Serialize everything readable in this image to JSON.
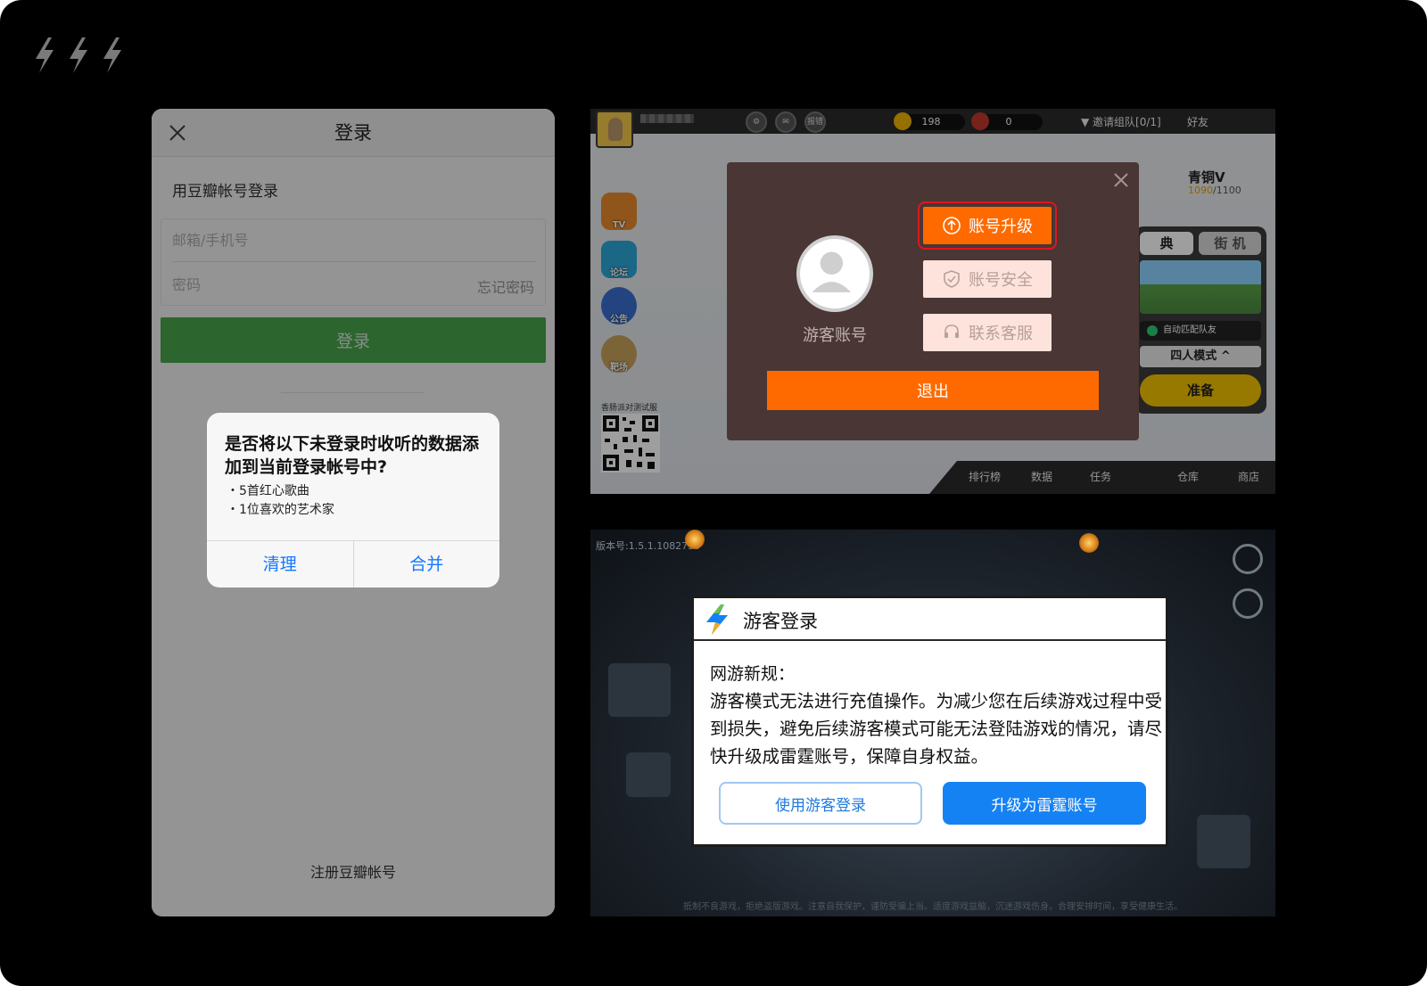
{
  "panel_login": {
    "title": "登录",
    "subtitle": "用豆瓣帐号登录",
    "email_placeholder": "邮箱/手机号",
    "password_placeholder": "密码",
    "forgot_password": "忘记密码",
    "login_button": "登录",
    "register_link": "注册豆瓣帐号",
    "dialog": {
      "title": "是否将以下未登录时收听的数据添加到当前登录帐号中?",
      "items": [
        "・5首红心歌曲",
        "・1位喜欢的艺术家"
      ],
      "clear_button": "清理",
      "merge_button": "合并"
    }
  },
  "panel_game_menu": {
    "coins": "198",
    "gems": "0",
    "report_label": "报错",
    "invite_team": "▼ 邀请组队[0/1]",
    "friends": "好友",
    "side_icons": [
      {
        "icon": "tv-icon",
        "label": "TV"
      },
      {
        "icon": "tap-forum-icon",
        "label": "论坛"
      },
      {
        "icon": "announcement-icon",
        "label": "公告"
      },
      {
        "icon": "range-icon",
        "label": "靶场"
      }
    ],
    "qr_label": "香肠派对测试服",
    "rank_name": "青铜V",
    "rank_points": "1090",
    "rank_points_max": "/1100",
    "tabs": [
      "典",
      "街 机"
    ],
    "auto_match": "自动匹配队友",
    "mode": "四人模式",
    "mode_arrow": "^",
    "ready": "准备",
    "bottom_nav": [
      "排行榜",
      "数据",
      "任务",
      "仓库",
      "商店"
    ],
    "modal": {
      "guest_account": "游客账号",
      "upgrade": "账号升级",
      "security": "账号安全",
      "service": "联系客服",
      "logout": "退出"
    },
    "colors": {
      "accent": "#ff6a00",
      "highlight": "#e0161d"
    }
  },
  "panel_guest_login": {
    "version": "版本号:1.5.1.1082730",
    "footer": "抵制不良游戏，拒绝盗版游戏。注意自我保护，谨防受骗上当。适度游戏益脑，沉迷游戏伤身。合理安排时间，享受健康生活。",
    "title": "游客登录",
    "heading": "网游新规：",
    "body": " 游客模式无法进行充值操作。为减少您在后续游戏过程中受到损失，避免后续游客模式可能无法登陆游戏的情况，请尽快升级成雷霆账号，保障自身权益。",
    "guest_button": "使用游客登录",
    "upgrade_button": "升级为雷霆账号",
    "colors": {
      "primary": "#1582f4"
    }
  }
}
